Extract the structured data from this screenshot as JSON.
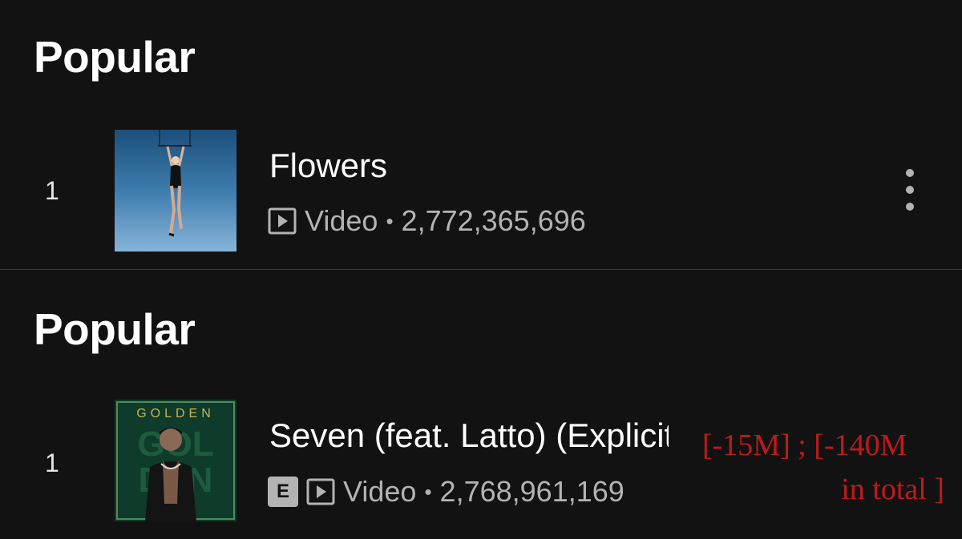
{
  "sections": [
    {
      "heading": "Popular",
      "track": {
        "rank": "1",
        "title": "Flowers",
        "type": "Video",
        "separator": "•",
        "plays": "2,772,365,696",
        "explicit": false
      }
    },
    {
      "heading": "Popular",
      "track": {
        "rank": "1",
        "title": "Seven (feat. Latto) (Explicit Ver.)",
        "type": "Video",
        "separator": "•",
        "plays": "2,768,961,169",
        "explicit": true,
        "explicit_label": "E",
        "cover_text": "GOLDEN"
      }
    }
  ],
  "annotation": {
    "line1": "[-15M] ; [-140M",
    "line2": "in total ]",
    "color": "#c0191c"
  },
  "colors": {
    "background": "#121212",
    "primary_text": "#ffffff",
    "secondary_text": "#b3b3b3"
  },
  "icons": [
    "video-icon",
    "more-options-icon",
    "explicit-badge"
  ]
}
